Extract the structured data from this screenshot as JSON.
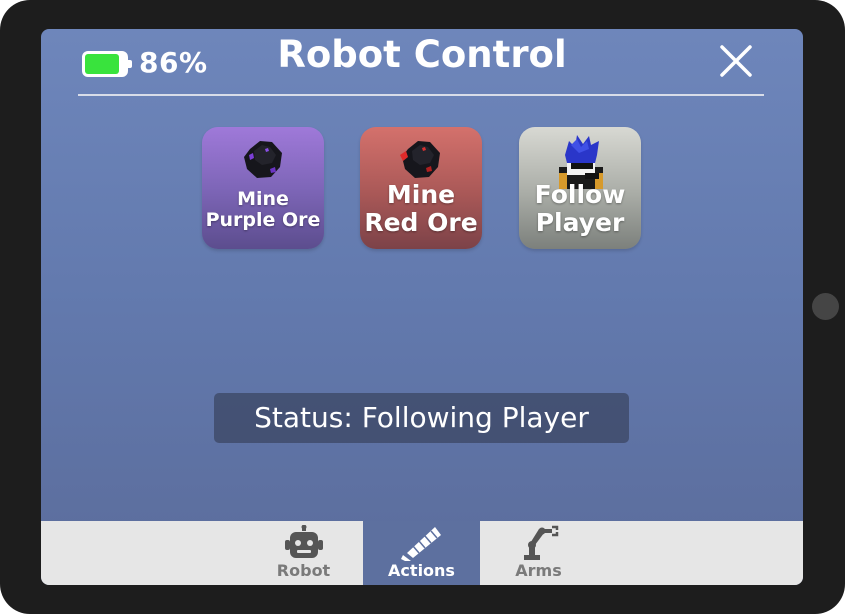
{
  "header": {
    "battery_text": "86%",
    "title": "Robot Control",
    "close_icon": "close-icon"
  },
  "actions": [
    {
      "label_line1": "Mine",
      "label_line2": "Purple Ore",
      "icon": "purple-ore-icon"
    },
    {
      "label_line1": "Mine",
      "label_line2": "Red Ore",
      "icon": "red-ore-icon"
    },
    {
      "label_line1": "Follow",
      "label_line2": "Player",
      "icon": "player-avatar-icon"
    }
  ],
  "status": {
    "text": "Status: Following Player"
  },
  "tabs": [
    {
      "label": "Robot",
      "icon": "robot-icon",
      "active": false
    },
    {
      "label": "Actions",
      "icon": "drill-icon",
      "active": true
    },
    {
      "label": "Arms",
      "icon": "robot-arm-icon",
      "active": false
    }
  ],
  "colors": {
    "screen_bg": "#6e86bb",
    "battery_fill": "#39e33d",
    "active_tab": "#5d709f",
    "tabbar_bg": "#e6e6e6"
  },
  "battery_level": 0.86
}
